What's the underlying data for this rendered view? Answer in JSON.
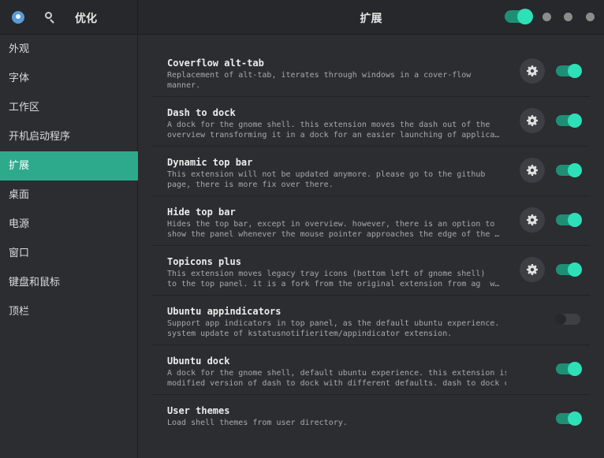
{
  "header": {
    "app_title": "优化",
    "page_title": "扩展",
    "icons": [
      "app-icon",
      "search-icon"
    ]
  },
  "sidebar": {
    "items": [
      {
        "label": "外观"
      },
      {
        "label": "字体"
      },
      {
        "label": "工作区"
      },
      {
        "label": "开机启动程序"
      },
      {
        "label": "扩展",
        "active": true
      },
      {
        "label": "桌面"
      },
      {
        "label": "电源"
      },
      {
        "label": "窗口"
      },
      {
        "label": "键盘和鼠标"
      },
      {
        "label": "顶栏"
      }
    ]
  },
  "extensions": {
    "global_enabled": true,
    "items": [
      {
        "name": "Coverflow alt-tab",
        "desc": "Replacement of alt-tab, iterates through windows in a cover-flow\nmanner.",
        "settings": true,
        "enabled": true
      },
      {
        "name": "Dash to dock",
        "desc": "A dock for the gnome shell. this extension moves the dash out of the\noverview transforming it in a dock for an easier launching of applica…",
        "settings": true,
        "enabled": true
      },
      {
        "name": "Dynamic top bar",
        "desc": "This extension will not be updated anymore. please go to the github\npage, there is more fix over there.",
        "settings": true,
        "enabled": true
      },
      {
        "name": "Hide top bar",
        "desc": "Hides the top bar, except in overview. however, there is an option to\nshow the panel whenever the mouse pointer approaches the edge of the …",
        "settings": true,
        "enabled": true
      },
      {
        "name": "Topicons plus",
        "desc": "This extension moves legacy tray icons (bottom left of gnome shell)\nto the top panel. it is a fork from the original extension from ag  w…",
        "settings": true,
        "enabled": true
      },
      {
        "name": "Ubuntu appindicators",
        "desc": "Support app indicators in top panel, as the default ubuntu experience.\nsystem update of kstatusnotifieritem/appindicator extension.",
        "settings": false,
        "enabled": false
      },
      {
        "name": "Ubuntu dock",
        "desc": "A dock for the gnome shell, default ubuntu experience. this extension is a\nmodified version of dash to dock with different defaults. dash to dock can b…",
        "settings": false,
        "enabled": true
      },
      {
        "name": "User themes",
        "desc": "Load shell themes from user directory.",
        "settings": false,
        "enabled": true
      }
    ]
  },
  "colors": {
    "accent": "#2daa8c",
    "toggle_on_knob": "#2ee0b8",
    "background": "#2b2d31",
    "header": "#26282c"
  }
}
